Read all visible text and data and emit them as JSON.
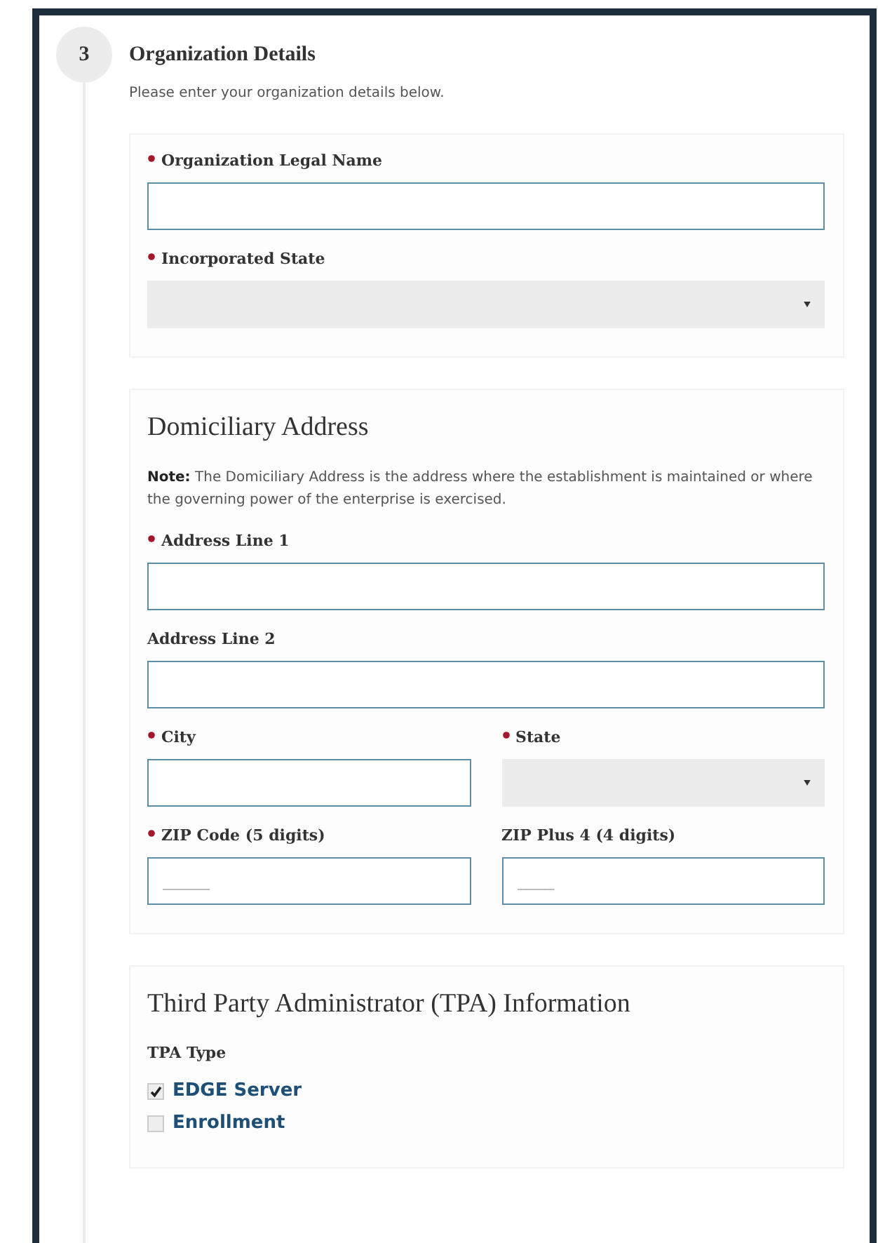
{
  "step": {
    "number": "3",
    "title": "Organization Details",
    "intro": "Please enter your organization details below."
  },
  "sections": [
    {
      "rows": [
        [
          {
            "kind": "text",
            "label": "Organization Legal Name",
            "required": true
          }
        ],
        [
          {
            "kind": "select",
            "label": "Incorporated State",
            "required": true
          }
        ]
      ]
    },
    {
      "title": "Domiciliary Address",
      "note": "**Note:** The Domiciliary Address is the address where the establishment is maintained or where the governing power of the enterprise is exercised.",
      "rows": [
        [
          {
            "kind": "text",
            "label": "Address Line 1",
            "required": true
          }
        ],
        [
          {
            "kind": "text",
            "label": "Address Line 2",
            "required": false
          }
        ],
        [
          {
            "kind": "text",
            "label": "City",
            "required": true
          },
          {
            "kind": "select",
            "label": "State",
            "required": true
          }
        ],
        [
          {
            "kind": "text",
            "label": "ZIP Code (5 digits)",
            "required": true,
            "placeholder": "_____"
          },
          {
            "kind": "text",
            "label": "ZIP Plus 4 (4 digits)",
            "required": false,
            "placeholder": "____"
          }
        ]
      ]
    },
    {
      "title": "Third Party Administrator (TPA) Information",
      "rows": [
        [
          {
            "kind": "checkboxes",
            "label": "TPA Type",
            "required": false,
            "options": [
              {
                "label": "EDGE Server",
                "checked": true
              },
              {
                "label": "Enrollment",
                "checked": false
              }
            ]
          }
        ]
      ]
    }
  ]
}
